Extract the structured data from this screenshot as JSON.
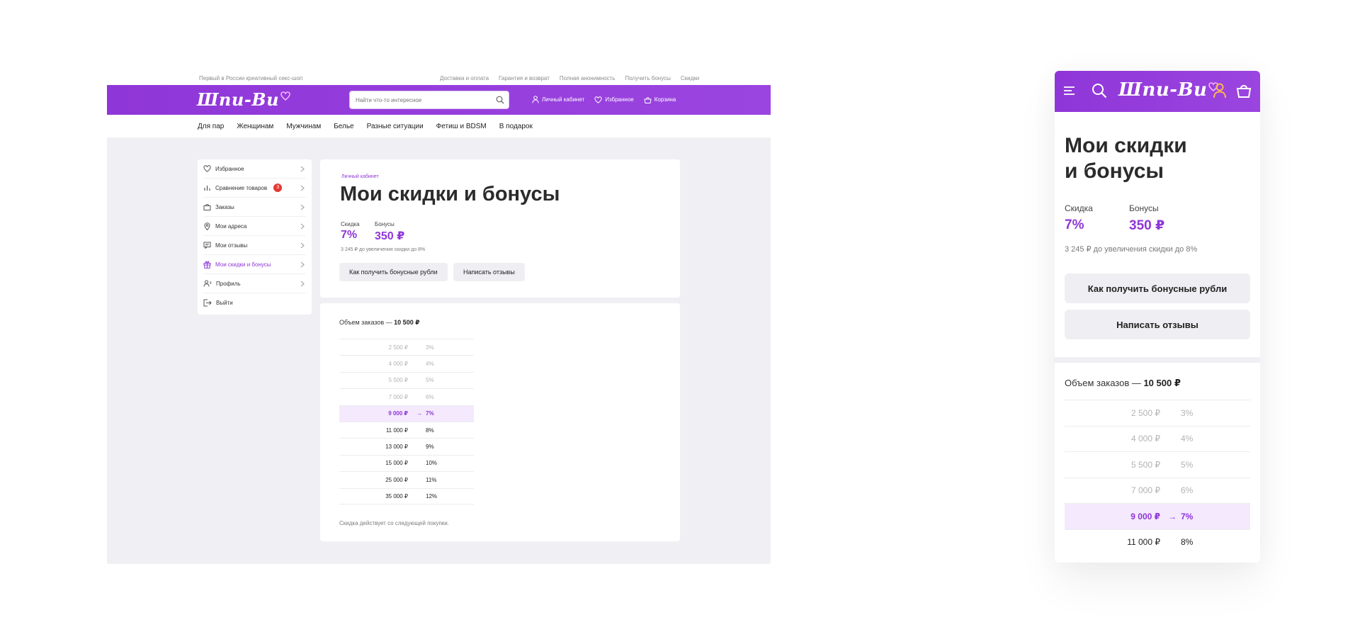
{
  "brand": {
    "logo": "Шпи-Ви",
    "tagline": "Первый в России креативный секс-шоп",
    "accent": "#8f36d8"
  },
  "desktop": {
    "toplinks": [
      "Доставка и оплата",
      "Гарантия и возврат",
      "Полная анонимность",
      "Получить бонусы",
      "Скидки"
    ],
    "search": {
      "placeholder": "Найти что-то интересное",
      "icon": "search-icon"
    },
    "header_links": [
      {
        "label": "Личный кабинет",
        "icon": "user-icon"
      },
      {
        "label": "Избранное",
        "icon": "heart-icon"
      },
      {
        "label": "Корзина",
        "icon": "cart-icon"
      }
    ],
    "nav": [
      "Для пар",
      "Женщинам",
      "Мужчинам",
      "Белье",
      "Разные ситуации",
      "Фетиш и BDSM",
      "В подарок"
    ],
    "sidebar": [
      {
        "label": "Избранное",
        "icon": "heart-icon"
      },
      {
        "label": "Сравнение товаров",
        "icon": "chart-icon",
        "badge": "3"
      },
      {
        "label": "Заказы",
        "icon": "bag-icon"
      },
      {
        "label": "Мои адреса",
        "icon": "location-icon"
      },
      {
        "label": "Мои отзывы",
        "icon": "review-icon"
      },
      {
        "label": "Мои скидки и бонусы",
        "icon": "gift-icon",
        "active": true
      },
      {
        "label": "Профиль",
        "icon": "profile-icon"
      },
      {
        "label": "Выйти",
        "icon": "logout-icon"
      }
    ]
  },
  "page": {
    "breadcrumb": "Личный кабинет",
    "title": "Мои скидки и бонусы",
    "mobile_title_line1": "Мои скидки",
    "mobile_title_line2": "и бонусы",
    "discount_label": "Скидка",
    "discount_value": "7%",
    "bonus_label": "Бонусы",
    "bonus_value": "350 ₽",
    "hint": "3 245 ₽ до увеличения скидки до 8%",
    "buttons": {
      "how_to_get": "Как получить бонусные рубли",
      "write_reviews": "Написать отзывы"
    },
    "volume_label": "Объем заказов — ",
    "volume_value": "10 500 ₽",
    "tiers": [
      {
        "amount": "2 500 ₽",
        "percent": "3%",
        "state": "past"
      },
      {
        "amount": "4 000 ₽",
        "percent": "4%",
        "state": "past"
      },
      {
        "amount": "5 500 ₽",
        "percent": "5%",
        "state": "past"
      },
      {
        "amount": "7 000 ₽",
        "percent": "6%",
        "state": "past"
      },
      {
        "amount": "9 000 ₽",
        "percent": "7%",
        "state": "current",
        "arrow": "→"
      },
      {
        "amount": "11 000 ₽",
        "percent": "8%",
        "state": "future"
      },
      {
        "amount": "13 000 ₽",
        "percent": "9%",
        "state": "future"
      },
      {
        "amount": "15 000 ₽",
        "percent": "10%",
        "state": "future"
      },
      {
        "amount": "25 000 ₽",
        "percent": "11%",
        "state": "future"
      },
      {
        "amount": "35 000 ₽",
        "percent": "12%",
        "state": "future"
      }
    ],
    "note": "Скидка действует со следующей покупки."
  },
  "mobile": {
    "header_icons": [
      "menu-icon",
      "search-icon",
      "user-icon",
      "cart-icon"
    ],
    "visible_tiers": 6
  }
}
